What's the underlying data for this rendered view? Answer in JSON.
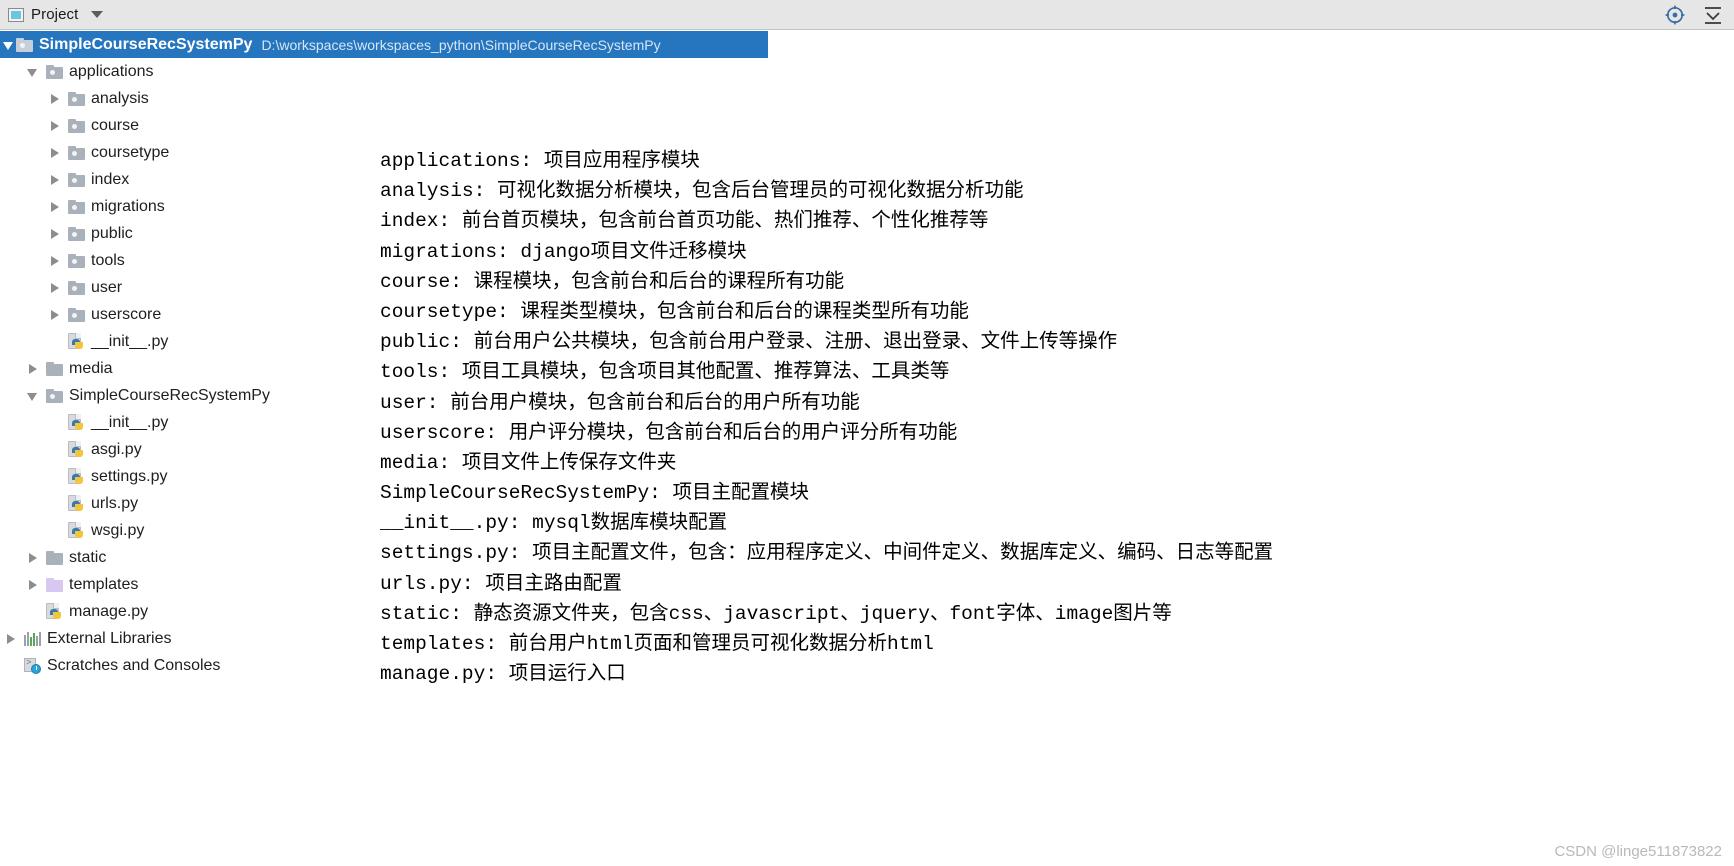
{
  "toolwindow": {
    "title": "Project",
    "icons": {
      "locate": "locate-icon",
      "collapse_all": "collapse-all-icon",
      "dropdown": "chevron-down-icon",
      "project": "project-icon"
    }
  },
  "tree": {
    "root": {
      "label": "SimpleCourseRecSystemPy",
      "path": "D:\\workspaces\\workspaces_python\\SimpleCourseRecSystemPy",
      "selected": true
    },
    "items": [
      {
        "label": "applications",
        "indent": 1,
        "arrow": "down",
        "icon": "folder-source-icon"
      },
      {
        "label": "analysis",
        "indent": 2,
        "arrow": "right",
        "icon": "folder-source-icon"
      },
      {
        "label": "course",
        "indent": 2,
        "arrow": "right",
        "icon": "folder-source-icon"
      },
      {
        "label": "coursetype",
        "indent": 2,
        "arrow": "right",
        "icon": "folder-source-icon"
      },
      {
        "label": "index",
        "indent": 2,
        "arrow": "right",
        "icon": "folder-source-icon"
      },
      {
        "label": "migrations",
        "indent": 2,
        "arrow": "right",
        "icon": "folder-source-icon"
      },
      {
        "label": "public",
        "indent": 2,
        "arrow": "right",
        "icon": "folder-source-icon"
      },
      {
        "label": "tools",
        "indent": 2,
        "arrow": "right",
        "icon": "folder-source-icon"
      },
      {
        "label": "user",
        "indent": 2,
        "arrow": "right",
        "icon": "folder-source-icon"
      },
      {
        "label": "userscore",
        "indent": 2,
        "arrow": "right",
        "icon": "folder-source-icon"
      },
      {
        "label": "__init__.py",
        "indent": 2,
        "arrow": "none",
        "icon": "python-file-icon"
      },
      {
        "label": "media",
        "indent": 1,
        "arrow": "right",
        "icon": "folder-plain-icon"
      },
      {
        "label": "SimpleCourseRecSystemPy",
        "indent": 1,
        "arrow": "down",
        "icon": "folder-source-icon"
      },
      {
        "label": "__init__.py",
        "indent": 2,
        "arrow": "none",
        "icon": "python-file-icon"
      },
      {
        "label": "asgi.py",
        "indent": 2,
        "arrow": "none",
        "icon": "python-file-icon"
      },
      {
        "label": "settings.py",
        "indent": 2,
        "arrow": "none",
        "icon": "python-file-icon"
      },
      {
        "label": "urls.py",
        "indent": 2,
        "arrow": "none",
        "icon": "python-file-icon"
      },
      {
        "label": "wsgi.py",
        "indent": 2,
        "arrow": "none",
        "icon": "python-file-icon"
      },
      {
        "label": "static",
        "indent": 1,
        "arrow": "right",
        "icon": "folder-plain-icon"
      },
      {
        "label": "templates",
        "indent": 1,
        "arrow": "right",
        "icon": "folder-template-icon"
      },
      {
        "label": "manage.py",
        "indent": 1,
        "arrow": "none",
        "icon": "python-file-icon"
      },
      {
        "label": "External Libraries",
        "indent": 0,
        "arrow": "right",
        "icon": "external-libraries-icon"
      },
      {
        "label": "Scratches and Consoles",
        "indent": 0,
        "arrow": "none",
        "icon": "scratches-icon"
      }
    ]
  },
  "description": {
    "lines": [
      "applications: 项目应用程序模块",
      "analysis: 可视化数据分析模块，包含后台管理员的可视化数据分析功能",
      "index: 前台首页模块，包含前台首页功能、热们推荐、个性化推荐等",
      "migrations: django项目文件迁移模块",
      "course: 课程模块，包含前台和后台的课程所有功能",
      "coursetype: 课程类型模块，包含前台和后台的课程类型所有功能",
      "public: 前台用户公共模块，包含前台用户登录、注册、退出登录、文件上传等操作",
      "tools: 项目工具模块，包含项目其他配置、推荐算法、工具类等",
      "user: 前台用户模块，包含前台和后台的用户所有功能",
      "userscore: 用户评分模块，包含前台和后台的用户评分所有功能",
      "media: 项目文件上传保存文件夹",
      "SimpleCourseRecSystemPy: 项目主配置模块",
      "__init__.py: mysql数据库模块配置",
      "settings.py: 项目主配置文件，包含：应用程序定义、中间件定义、数据库定义、编码、日志等配置",
      "urls.py: 项目主路由配置",
      "static: 静态资源文件夹，包含css、javascript、jquery、font字体、image图片等",
      "templates: 前台用户html页面和管理员可视化数据分析html",
      "manage.py: 项目运行入口"
    ]
  },
  "watermark": {
    "text": "CSDN @linge511873822"
  },
  "colors": {
    "selection": "#2675bf",
    "header_bg": "#e6e6e6",
    "folder": "#a9b2ba",
    "template_folder": "#d6c8f0",
    "python_blue": "#3c78aa",
    "python_yellow": "#f2c53d",
    "watermark": "#b9b9b9"
  }
}
